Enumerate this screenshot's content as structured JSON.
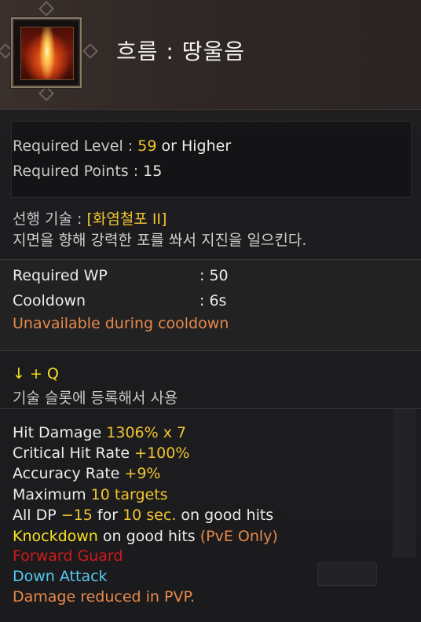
{
  "skill": {
    "title": "흐름 : 땅울음",
    "icon": "fire-pillar-icon"
  },
  "requirements": {
    "level_label": "Required Level :",
    "level_value": "59",
    "level_suffix": "or Higher",
    "points_label": "Required Points :",
    "points_value": "15"
  },
  "prereq": {
    "label": "선행 기술 :",
    "value": "[화염철포 II]"
  },
  "description": "지면을 향해 강력한 포를 쏴서 지진을 일으킨다.",
  "cost": {
    "wp_label": "Required WP",
    "wp_value": ": 50",
    "cooldown_label": "Cooldown",
    "cooldown_value": ": 6s",
    "cooldown_note": "Unavailable during cooldown"
  },
  "command": {
    "keys": "↓ + Q",
    "note": "기술 슬롯에 등록해서 사용"
  },
  "effects": {
    "hit_damage_label": "Hit Damage",
    "hit_damage_value": "1306% x 7",
    "crit_label": "Critical Hit Rate",
    "crit_value": "+100%",
    "accuracy_label": "Accuracy Rate",
    "accuracy_value": "+9%",
    "maximum_label": "Maximum",
    "maximum_value": "10 targets",
    "dp_label": "All DP",
    "dp_value": "−15",
    "dp_for": "for",
    "dp_duration": "10 sec.",
    "dp_suffix": "on good hits",
    "knockdown": "Knockdown",
    "knockdown_suffix": "on good hits",
    "knockdown_note": "(PvE Only)",
    "forward_guard": "Forward Guard",
    "down_attack": "Down Attack",
    "pvp_note": "Damage reduced in PVP."
  },
  "colors": {
    "gold": "#f0c430",
    "yellow": "#f6e020",
    "orange": "#e8894a",
    "red": "#d11a1a",
    "blue": "#56c8f0"
  }
}
